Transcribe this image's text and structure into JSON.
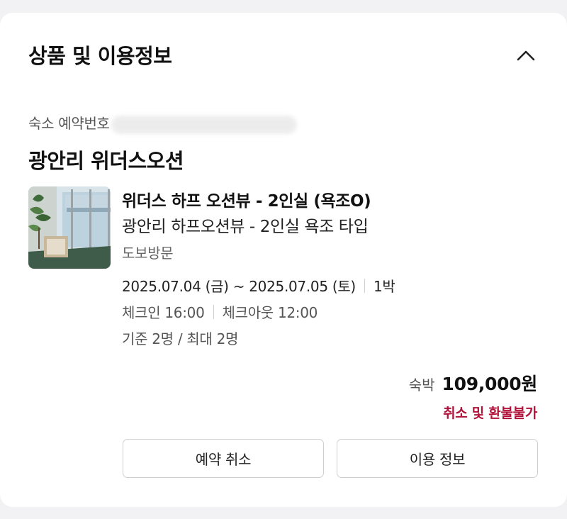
{
  "section": {
    "title": "상품 및 이용정보",
    "collapse_icon": "chevron-up-icon"
  },
  "reservation": {
    "number_label": "숙소 예약번호"
  },
  "hotel": {
    "name": "광안리 위더스오션"
  },
  "room": {
    "title": "위더스 하프 오션뷰 - 2인실 (욕조O)",
    "subtitle": "광안리 하프오션뷰 - 2인실 욕조 타입",
    "stay_type": "도보방문",
    "date_range": "2025.07.04 (금) ~ 2025.07.05 (토)",
    "nights": "1박",
    "checkin": "체크인 16:00",
    "checkout": "체크아웃 12:00",
    "occupancy": "기준 2명 / 최대 2명"
  },
  "price": {
    "label": "숙박",
    "value": "109,000원",
    "refund_note": "취소 및 환불불가",
    "refund_color": "#b0123a"
  },
  "actions": {
    "cancel_label": "예약 취소",
    "info_label": "이용 정보"
  }
}
